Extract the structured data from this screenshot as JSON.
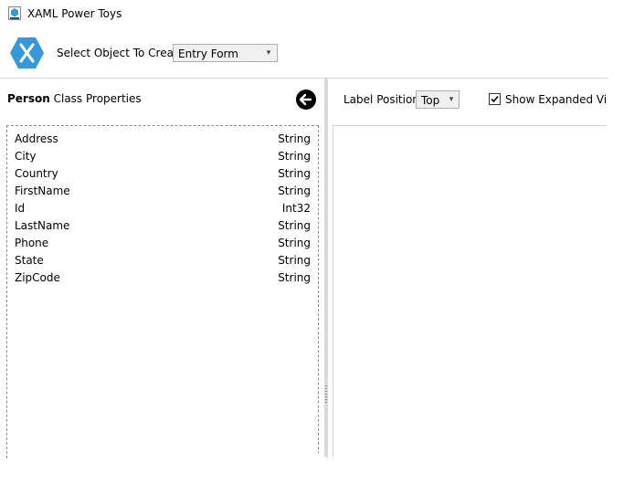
{
  "window": {
    "title": "XAML Power Toys"
  },
  "toolbar": {
    "select_label": "Select Object To Create",
    "object_type": {
      "selected": "Entry Form"
    }
  },
  "class_panel": {
    "class_name": "Person",
    "header_suffix": "Class Properties",
    "properties": [
      {
        "name": "Address",
        "type": "String"
      },
      {
        "name": "City",
        "type": "String"
      },
      {
        "name": "Country",
        "type": "String"
      },
      {
        "name": "FirstName",
        "type": "String"
      },
      {
        "name": "Id",
        "type": "Int32"
      },
      {
        "name": "LastName",
        "type": "String"
      },
      {
        "name": "Phone",
        "type": "String"
      },
      {
        "name": "State",
        "type": "String"
      },
      {
        "name": "ZipCode",
        "type": "String"
      }
    ]
  },
  "options_panel": {
    "label_position_label": "Label Position",
    "label_position": {
      "selected": "Top"
    },
    "show_expanded_label": "Show Expanded Vi",
    "show_expanded_checked": true
  },
  "colors": {
    "brand": "#3498DB",
    "panel_border": "#8a8a8a"
  },
  "icons": [
    "xaml-app-icon",
    "xamarin-logo-icon",
    "back-arrow-icon",
    "chevron-down-icon",
    "checkmark-icon",
    "splitter-grip-icon"
  ]
}
